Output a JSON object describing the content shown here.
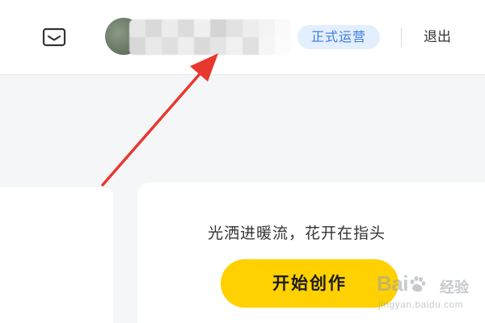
{
  "header": {
    "status_badge": "正式运营",
    "logout_label": "退出"
  },
  "card": {
    "slogan": "光洒进暖流，花开在指头",
    "start_button_label": "开始创作"
  },
  "watermark": {
    "brand_text": "Bai",
    "brand_suffix": "经验",
    "url": "jingyan.baidu.com"
  },
  "icons": {
    "mail": "mail-icon",
    "paw": "baidu-paw-icon"
  },
  "colors": {
    "accent_yellow": "#ffd100",
    "badge_bg": "#e3effd",
    "badge_text": "#3a7be0",
    "arrow_red": "#e8372f"
  }
}
